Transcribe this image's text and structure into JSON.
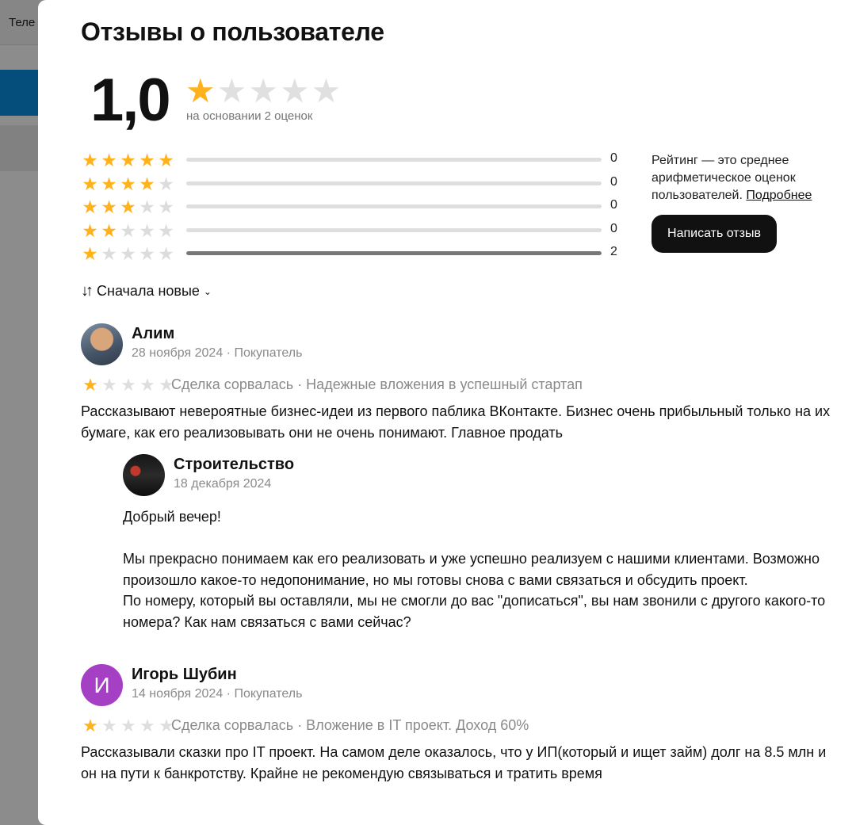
{
  "background": {
    "header_text": "Теле"
  },
  "drawer": {
    "title": "Отзывы о пользователе",
    "rating_value": "1,0",
    "rating_stars": 1,
    "rating_basis": "на основании 2 оценок",
    "distribution": [
      {
        "stars": 5,
        "count": "0",
        "share": 0
      },
      {
        "stars": 4,
        "count": "0",
        "share": 0
      },
      {
        "stars": 3,
        "count": "0",
        "share": 0
      },
      {
        "stars": 2,
        "count": "0",
        "share": 0
      },
      {
        "stars": 1,
        "count": "2",
        "share": 1
      }
    ],
    "info_text": "Рейтинг — это среднее арифметическое оценок пользователей.",
    "info_link": "Подробнее",
    "write_button": "Написать отзыв",
    "sort_label": "Сначала новые"
  },
  "reviews": [
    {
      "author": "Алим",
      "meta": "28 ноября 2024 · Покупатель",
      "stars": 1,
      "tags": "Сделка сорвалась · Надежные вложения в успешный стартап",
      "text": "Рассказывают невероятные бизнес-идеи из первого паблика ВКонтакте. Бизнес очень прибыльный только на их бумаге, как его реализовывать они не очень понимают. Главное продать",
      "reply": {
        "author": "Строительство",
        "date": "18 декабря 2024",
        "text": "Добрый вечер!\n\nМы прекрасно понимаем как его реализовать и уже успешно реализуем с нашими клиентами. Возможно произошло какое-то недопонимание, но мы готовы снова с вами связаться и обсудить проект.\nПо номеру, который вы оставляли, мы не смогли до вас \"дописаться\", вы нам звонили с другого какого-то номера? Как нам связаться с вами сейчас?"
      }
    },
    {
      "author": "Игорь Шубин",
      "avatar_letter": "И",
      "meta": "14 ноября 2024 · Покупатель",
      "stars": 1,
      "tags": "Сделка сорвалась · Вложение в IT проект. Доход 60%",
      "text": "Рассказывали сказки про IT проект. На самом деле оказалось, что у ИП(который и ищет займ) долг на 8.5 млн и он на пути к банкротству. Крайне не рекомендую связываться и тратить время"
    }
  ],
  "colors": {
    "star_on": "#ffb21d",
    "star_off": "#dedede",
    "button_bg": "#111111",
    "avatar_purple": "#a53fc4",
    "overlay_blue": "#0a8fe0"
  }
}
